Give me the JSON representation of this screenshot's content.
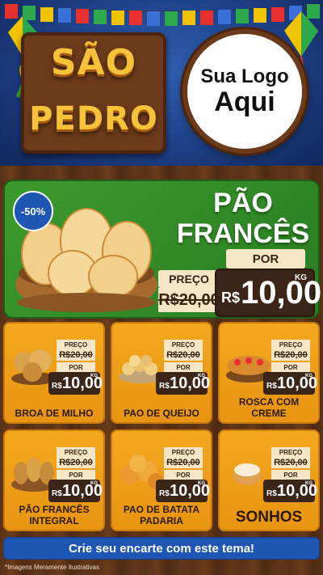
{
  "header": {
    "title_line1": "SÃO",
    "title_line2": "PEDRO",
    "logo_line1": "Sua Logo",
    "logo_line2": "Aqui"
  },
  "hero": {
    "discount": "-50%",
    "name_line1": "PÃO",
    "name_line2": "FRANCÊS",
    "preco_label": "PREÇO",
    "old_price": "R$20,00",
    "por_label": "POR",
    "currency": "R$",
    "new_price": "10,00",
    "unit": "KG"
  },
  "products": [
    {
      "name": "BROA DE MILHO",
      "preco_label": "PREÇO",
      "old_price": "R$20,00",
      "por_label": "POR",
      "currency": "R$",
      "new_price": "10,00",
      "unit": "KG"
    },
    {
      "name": "PAO DE QUEIJO",
      "preco_label": "PREÇO",
      "old_price": "R$20,00",
      "por_label": "POR",
      "currency": "R$",
      "new_price": "10,00",
      "unit": "KG"
    },
    {
      "name": "ROSCA COM CREME",
      "preco_label": "PREÇO",
      "old_price": "R$20,00",
      "por_label": "POR",
      "currency": "R$",
      "new_price": "10,00",
      "unit": "KG"
    },
    {
      "name": "PÃO FRANCÊS INTEGRAL",
      "preco_label": "PREÇO",
      "old_price": "R$20,00",
      "por_label": "POR",
      "currency": "R$",
      "new_price": "10,00",
      "unit": "KG"
    },
    {
      "name": "PAO DE BATATA PADARIA",
      "preco_label": "PREÇO",
      "old_price": "R$20,00",
      "por_label": "POR",
      "currency": "R$",
      "new_price": "10,00",
      "unit": "KG"
    },
    {
      "name": "SONHOS",
      "preco_label": "PREÇO",
      "old_price": "R$20,00",
      "por_label": "POR",
      "currency": "R$",
      "new_price": "10,00",
      "unit": "KG"
    }
  ],
  "cta": {
    "label": "Crie seu encarte com este tema!"
  },
  "disclaimer": "*Imagens Meramente Ilustrativas",
  "colors": {
    "header_blue": "#1d3f85",
    "hero_green": "#2f8a26",
    "card_orange": "#f3a81e",
    "price_dark": "#3b2418",
    "cta_blue": "#1f56b3",
    "title_gold": "#f6c23a"
  }
}
